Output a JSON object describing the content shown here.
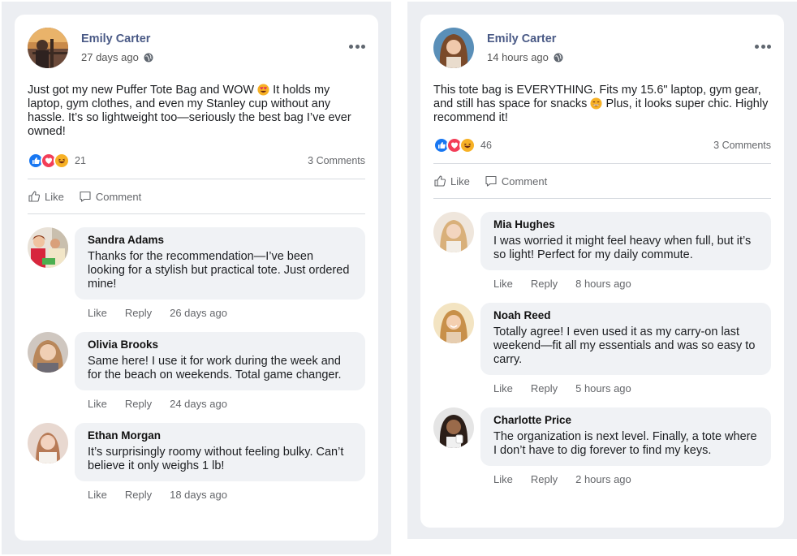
{
  "posts": [
    {
      "author": "Emily Carter",
      "time": "27 days ago",
      "privacy_icon": "globe-icon",
      "text_parts": [
        "Just got my new Puffer Tote Bag and WOW ",
        " It holds my laptop, gym clothes, and even my Stanley cup without any hassle. It’s so lightweight too—seriously the best bag I’ve ever owned!"
      ],
      "emoji": "heart-eyes-emoji",
      "reactions": [
        "like",
        "love",
        "haha"
      ],
      "reaction_count": "21",
      "comments_label": "3 Comments",
      "like_label": "Like",
      "comment_label": "Comment",
      "comments": [
        {
          "name": "Sandra Adams",
          "text": "Thanks for the recommendation—I’ve been looking for a stylish but practical tote. Just ordered mine!",
          "like": "Like",
          "reply": "Reply",
          "time": "26 days ago"
        },
        {
          "name": "Olivia Brooks",
          "text": "Same here! I use it for work during the week and for the beach on weekends. Total game changer.",
          "like": "Like",
          "reply": "Reply",
          "time": "24 days ago"
        },
        {
          "name": "Ethan Morgan",
          "text": "It’s surprisingly roomy without feeling bulky. Can’t believe it only weighs 1 lb!",
          "like": "Like",
          "reply": "Reply",
          "time": "18 days ago"
        }
      ]
    },
    {
      "author": "Emily Carter",
      "time": "14 hours ago",
      "privacy_icon": "globe-icon",
      "text_parts": [
        "This tote bag is EVERYTHING. Fits my 15.6\" laptop, gym gear, and still has space for snacks ",
        " Plus, it looks super chic. Highly recommend it!"
      ],
      "emoji": "grin-emoji",
      "reactions": [
        "like",
        "love",
        "haha"
      ],
      "reaction_count": "46",
      "comments_label": "3 Comments",
      "like_label": "Like",
      "comment_label": "Comment",
      "comments": [
        {
          "name": "Mia Hughes",
          "text": "I was worried it might feel heavy when full, but it’s so light! Perfect for my daily commute.",
          "like": "Like",
          "reply": "Reply",
          "time": "8 hours ago"
        },
        {
          "name": "Noah Reed",
          "text": "Totally agree! I even used it as my carry-on last weekend—fit all my essentials and was so easy to carry.",
          "like": "Like",
          "reply": "Reply",
          "time": "5 hours ago"
        },
        {
          "name": "Charlotte Price",
          "text": "The organization is next level. Finally, a tote where I don’t have to dig forever to find my keys.",
          "like": "Like",
          "reply": "Reply",
          "time": "2 hours ago"
        }
      ]
    }
  ],
  "colors": {
    "panel_bg": "#eceef2",
    "card_bg": "#ffffff",
    "author_name": "#4a5a86",
    "bubble_bg": "#f0f2f5",
    "like_blue": "#1877f2",
    "love_red": "#f33e58",
    "haha_yellow": "#f7b125"
  }
}
